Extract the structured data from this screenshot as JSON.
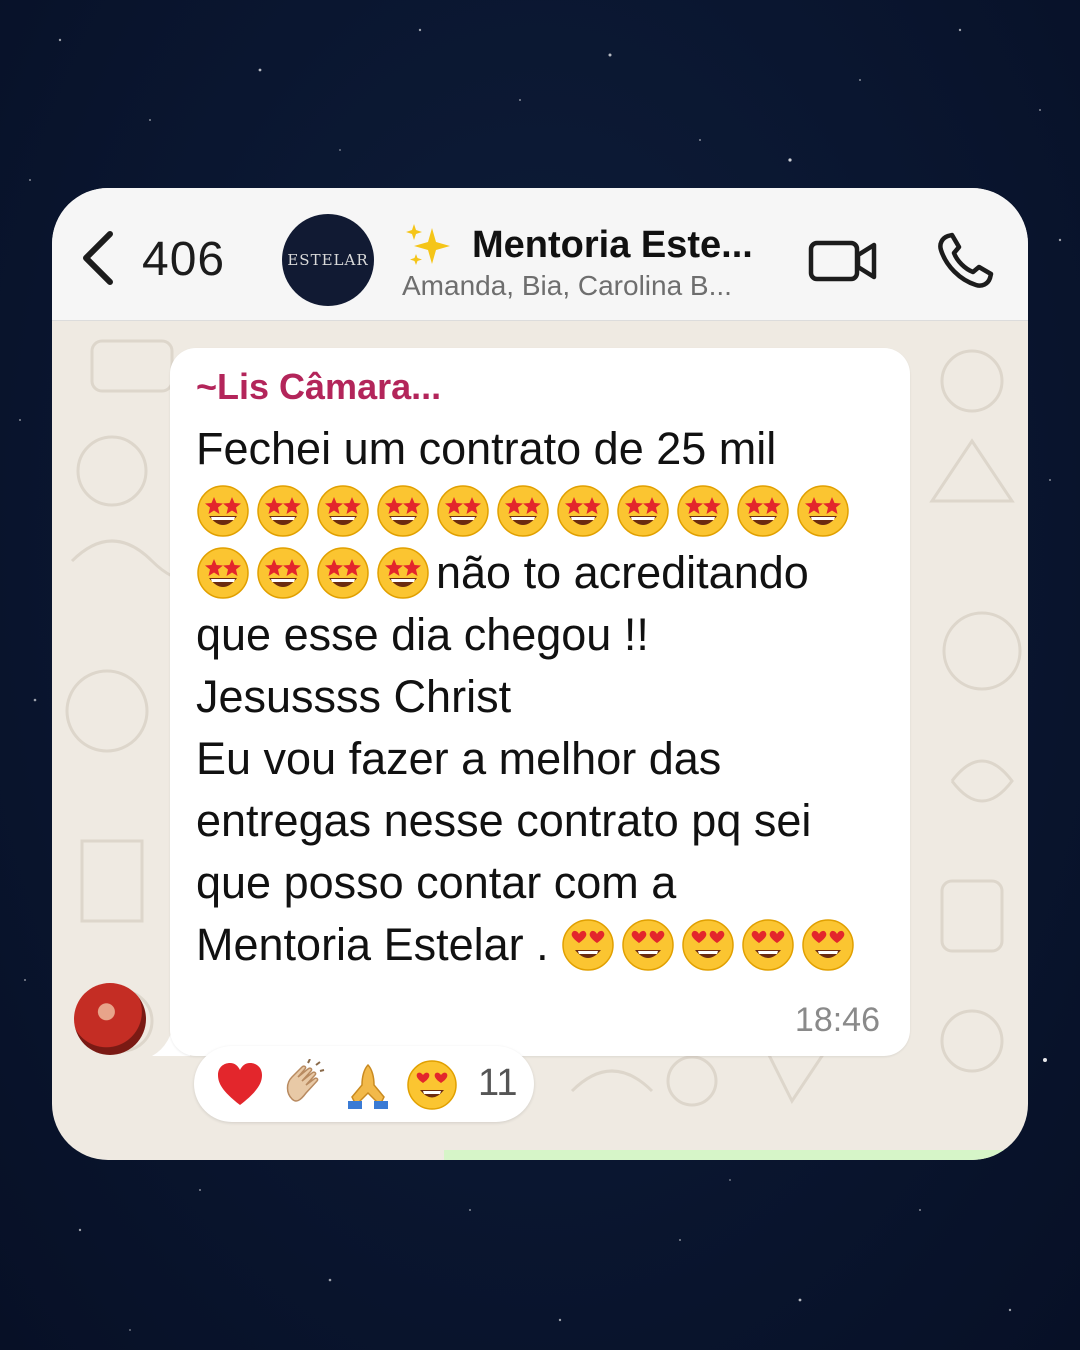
{
  "header": {
    "back_count": "406",
    "group_avatar_text": "ESTELAR",
    "group_title": "Mentoria Este...",
    "group_members": "Amanda, Bia, Carolina B..."
  },
  "message": {
    "sender": "~Lis Câmara...",
    "line1": "Fechei um contrato de 25 mil",
    "text_after_emojis": "não to acreditando",
    "line_rest": "que esse dia chegou !!\nJesussss Christ\nEu vou fazer a melhor das entregas nesse contrato pq sei que posso contar com a",
    "line_end": "Mentoria Estelar .",
    "time": "18:46"
  },
  "reactions": {
    "icons": [
      "heart-icon",
      "clapping-hands-icon",
      "praying-hands-icon",
      "heart-eyes-icon"
    ],
    "count": "11"
  },
  "colors": {
    "sender_name": "#b3255a",
    "chat_background": "#efeae2",
    "page_background": "#0a1630"
  }
}
